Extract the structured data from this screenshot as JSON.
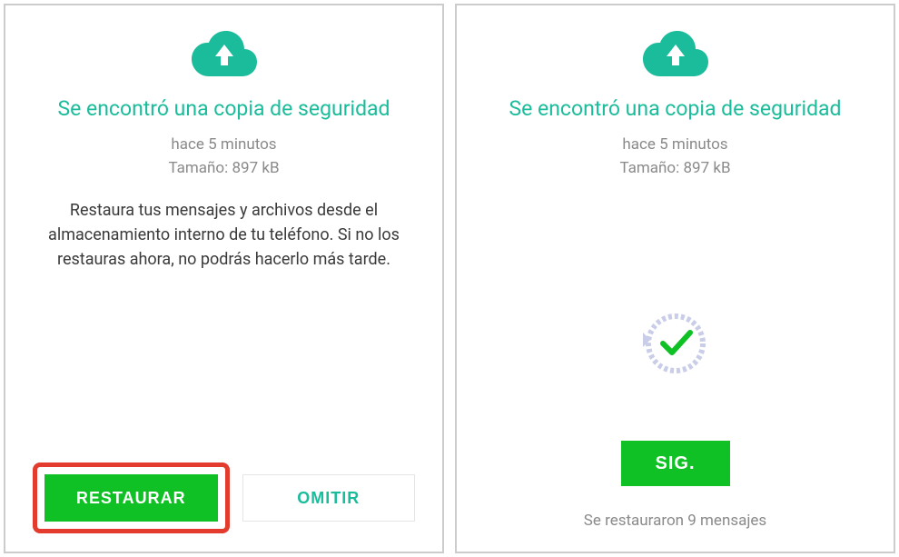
{
  "left": {
    "title": "Se encontró una copia de seguridad",
    "time": "hace 5 minutos",
    "size": "Tamaño: 897 kB",
    "description": "Restaura tus mensajes y archivos desde el almacenamiento interno de tu teléfono. Si no los restauras ahora, no podrás hacerlo más tarde.",
    "restore_label": "RESTAURAR",
    "skip_label": "OMITIR"
  },
  "right": {
    "title": "Se encontró una copia de seguridad",
    "time": "hace 5 minutos",
    "size": "Tamaño: 897 kB",
    "next_label": "SIG.",
    "status": "Se restauraron 9 mensajes"
  },
  "colors": {
    "accent": "#1bbc9b",
    "button_green": "#0fc124",
    "highlight_red": "#e33b2e"
  }
}
